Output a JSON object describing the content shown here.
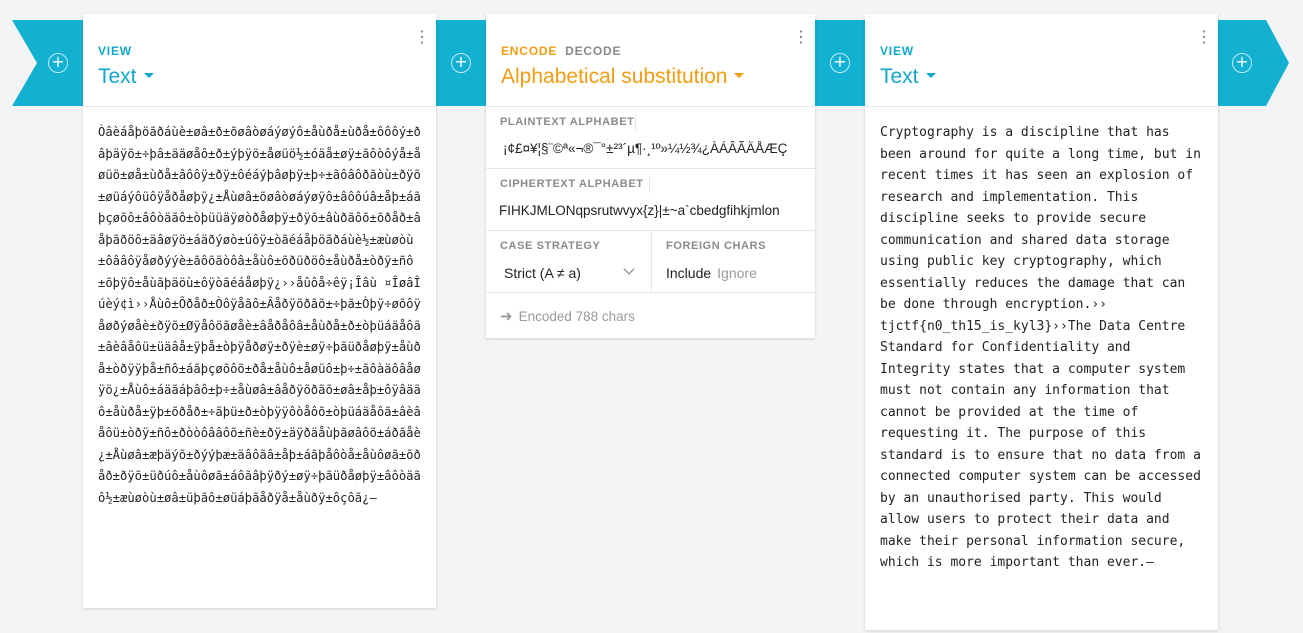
{
  "left_panel": {
    "mode": "VIEW",
    "format": "Text",
    "content": "Òâèáåþöãðáùè±øâ±ð±õøâòøáýøýô±åùðå±ùðå±ôôôý±ðâþäÿõ±÷þâ±ääøåô±ð±ýþÿö±åøüö½±óäå±øÿ±ãôòôýå±åøüö±øå±ùðå±âôôÿ±ðÿ±ôéáýþâøþÿ±þ÷±ãôâôðãòù±ðÿõ±øüáýôüôÿåðåøþÿ¿±Åùøâ±õøâòøáýøÿô±âôôúâ±åþ±áãþçøõô±âôòäãô±òþüüäÿøòðåøþÿ±ðÿõ±âùðãôõ±õðåð±âåþãðöô±äâøÿö±áäðýøò±úôÿ±òãéáåþöãðáùè½±æùøòù±ôââôÿåøðýýè±ãôõäòôâ±åùô±õðüðöô±åùðå±òðÿ±ñô±õþÿô±åùãþäöù±ôÿòãéáåøþÿ¿››åûôå÷êÿ¡Îâù ¤ÎøâÎúèý¢ì››Åùô±Õðåð±Òôÿåãô±Âåðÿõðãõ±÷þã±Òþÿ÷øõôÿåøðýøåè±ðÿõ±Øÿåôöãøåè±âåðåôâ±åùðå±ð±òþüáäåôã±âèâåôü±üäâå±ÿþå±òþÿåðøÿ±ðÿè±øÿ÷þãüðåøþÿ±åùðå±òðÿÿþå±ñô±áãþçøõôõ±ðå±åùô±åøüô±þ÷±ãôàäôâåøÿö¿±Åùô±áäãáþâô±þ÷±åùøâ±âåðÿõðãõ±øâ±åþ±ôÿâäãô±åùðå±ÿþ±õðåð±÷ãþü±ð±òþÿÿôòåôõ±òþüáäåôã±âèâåôü±òðÿ±ñô±ðòòôââôõ±ñè±ðÿ±äÿðäåùþãøâôõ±áðãåè¿±Åùøâ±æþäýõ±ðýýþæ±äâôãâ±åþ±áãþåôòå±åùôøã±õðåð±ðÿõ±üðúô±åùôøã±áôãâþÿðý±øÿ÷þãüðåøþÿ±âôòäãô½±æùøòù±øâ±üþãô±øüáþãåðÿå±åùðÿ±ôçôã¿–"
  },
  "middle_panel": {
    "tabs": [
      "ENCODE",
      "DECODE"
    ],
    "operation": "Alphabetical substitution",
    "plaintext_alphabet_label": "PLAINTEXT ALPHABET",
    "plaintext_alphabet": "¡¢£¤¥¦§¨©ª«¬®¯°±²³´µ¶·¸¹º»¼½¾¿ÀÁÂÃÄÅÆÇ",
    "ciphertext_alphabet_label": "CIPHERTEXT ALPHABET",
    "ciphertext_alphabet": "FIHKJMLONqpsrutwvyx{z}|±~a`cbedgfihkjmlon",
    "case_strategy_label": "CASE STRATEGY",
    "case_strategy": "Strict (A ≠ a)",
    "foreign_chars_label": "FOREIGN CHARS",
    "foreign_include": "Include",
    "foreign_ignore": "Ignore",
    "status": "Encoded 788 chars"
  },
  "right_panel": {
    "mode": "VIEW",
    "format": "Text",
    "content": "Cryptography is a discipline that has been around for quite a long time, but in recent times it has seen an explosion of research and implementation. This discipline seeks to provide secure communication and shared data storage using public key cryptography, which essentially reduces the damage that can be done through encryption.›› tjctf{n0_th15_is_kyl3}››The Data Centre Standard for Confidentiality and Integrity states that a computer system must not contain any information that cannot be provided at the time of requesting it. The purpose of this standard is to ensure that no data from a connected computer system can be accessed by an unauthorised party. This would allow users to protect their data and make their personal information secure, which is more important than ever.–"
  },
  "icons": {
    "add": "plus-circle-icon",
    "menu": "kebab-menu-icon",
    "dropdown": "caret-down-icon",
    "status": "arrow-right-icon"
  },
  "colors": {
    "accent_blue": "#11a7cc",
    "accent_orange": "#f39c12",
    "connector": "#12b0d1"
  }
}
